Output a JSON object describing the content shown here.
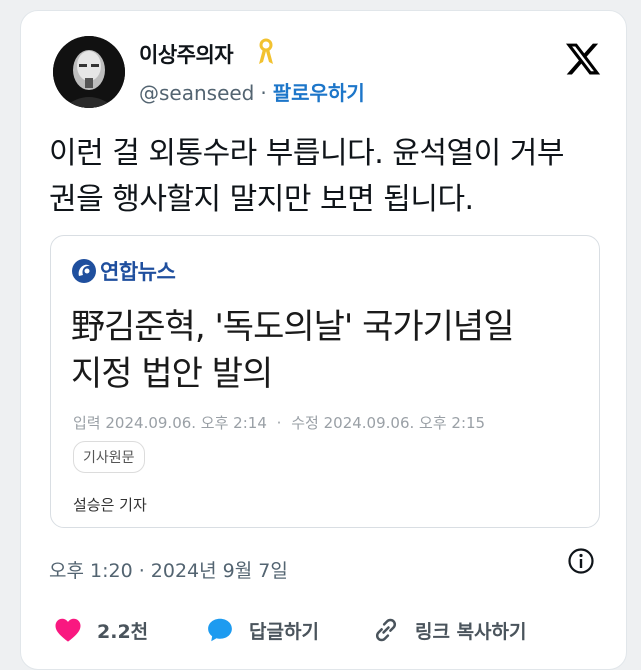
{
  "tweet": {
    "author": {
      "name": "이상주의자",
      "handle": "@seanseed",
      "follow_label": "팔로우하기",
      "separator": "·",
      "ribbon_color": "#f2c230"
    },
    "text_line1": "이런 걸 외통수라 부릅니다. 윤석열이 거부",
    "text_line2": "권을 행사할지 말지만 보면 됩니다.",
    "timestamp": "오후 1:20 · 2024년 9월 7일"
  },
  "link_card": {
    "source_name": "연합뉴스",
    "headline_line1": "野김준혁, '독도의날' 국가기념일",
    "headline_line2": "지정 법안 발의",
    "input_label": "입력",
    "input_date": "2024.09.06. 오후 2:14",
    "meta_separator": "·",
    "edit_label": "수정",
    "edit_date": "2024.09.06. 오후 2:15",
    "badge": "기사원문",
    "reporter": "설승은 기자",
    "brand_color": "#1f4f9e"
  },
  "actions": {
    "like_count": "2.2천",
    "reply_label": "답글하기",
    "copy_link_label": "링크 복사하기",
    "like_color": "#f91880",
    "reply_color": "#1d9bf0"
  },
  "icons": [
    "x-logo-icon",
    "ribbon-icon",
    "info-icon",
    "heart-icon",
    "reply-bubble-icon",
    "link-icon",
    "yonhap-logo-icon"
  ]
}
